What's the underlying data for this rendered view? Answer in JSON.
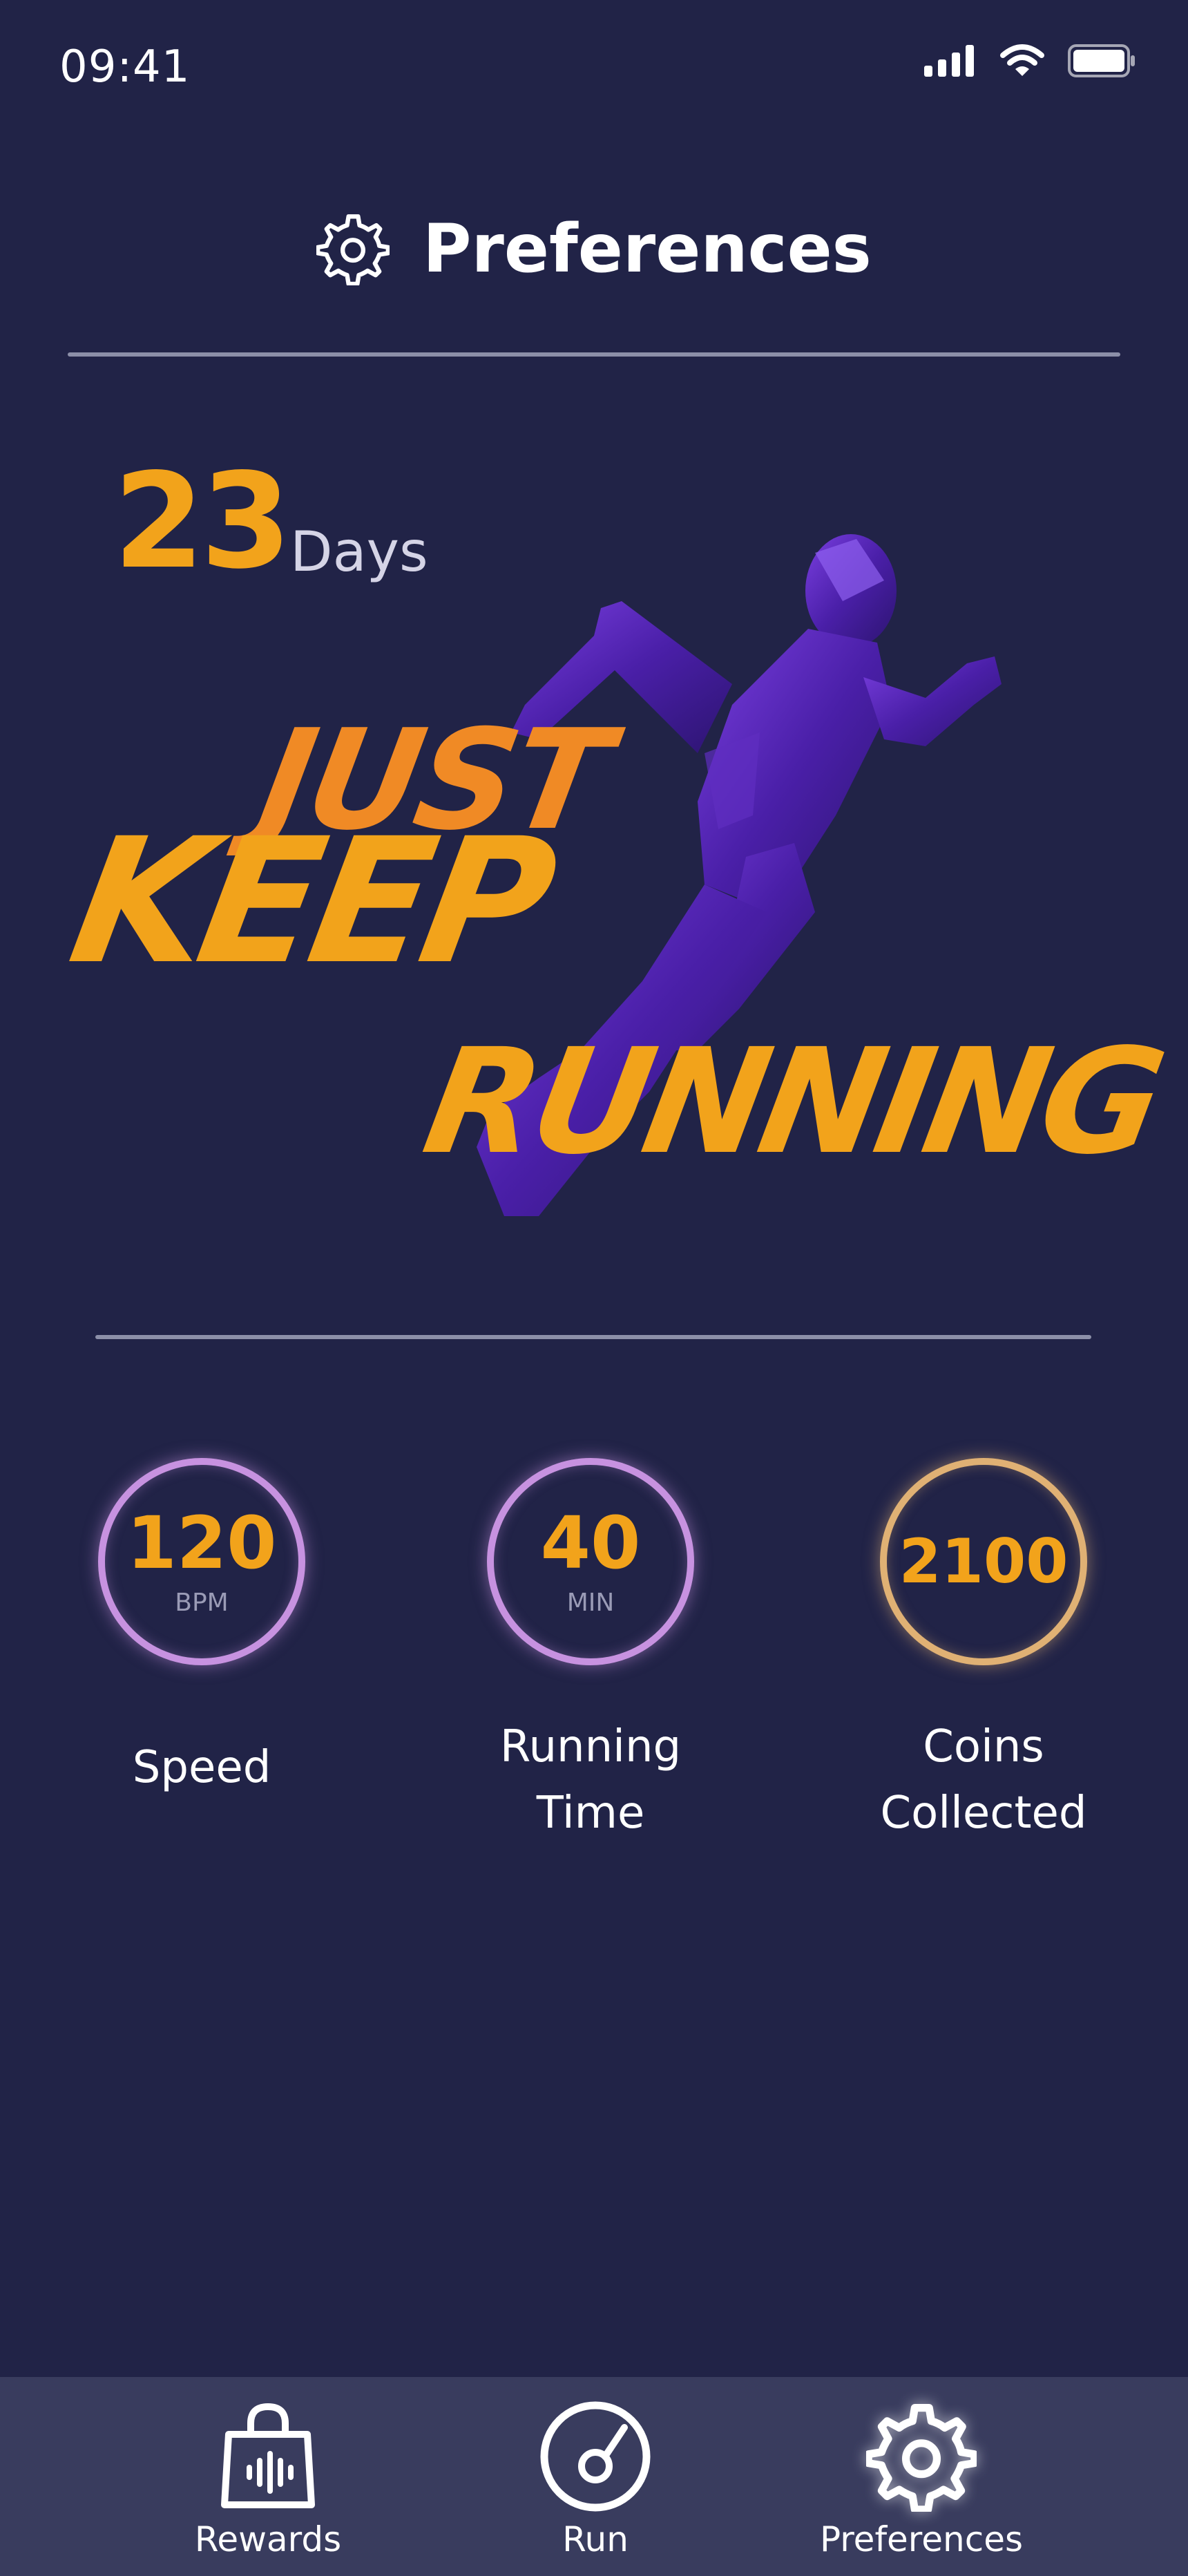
{
  "status_bar": {
    "time": "09:41",
    "icons": [
      "signal-icon",
      "wifi-icon",
      "battery-icon"
    ]
  },
  "header": {
    "icon": "gear-icon",
    "title": "Preferences"
  },
  "hero": {
    "days_number": "23",
    "days_label": "Days",
    "slogan": [
      "JUST",
      "KEEP",
      "RUNNING"
    ],
    "image": "runner-silhouette"
  },
  "stats": [
    {
      "value": "120",
      "unit": "BPM",
      "label": "Speed"
    },
    {
      "value": "40",
      "unit": "MIN",
      "label_line1": "Running",
      "label_line2": "Time"
    },
    {
      "value": "2100",
      "label_line1": "Coins",
      "label_line2": "Collected"
    }
  ],
  "nav": [
    {
      "label": "Rewards",
      "icon": "shopping-bag-icon"
    },
    {
      "label": "Run",
      "icon": "run-dial-icon"
    },
    {
      "label": "Preferences",
      "icon": "gear-icon",
      "active": true
    }
  ],
  "colors": {
    "background": "#212347",
    "accent": "#f2a31b",
    "ring_purple": "#c792e0",
    "ring_gold": "#e0b174",
    "nav_background": "#393c5e"
  }
}
